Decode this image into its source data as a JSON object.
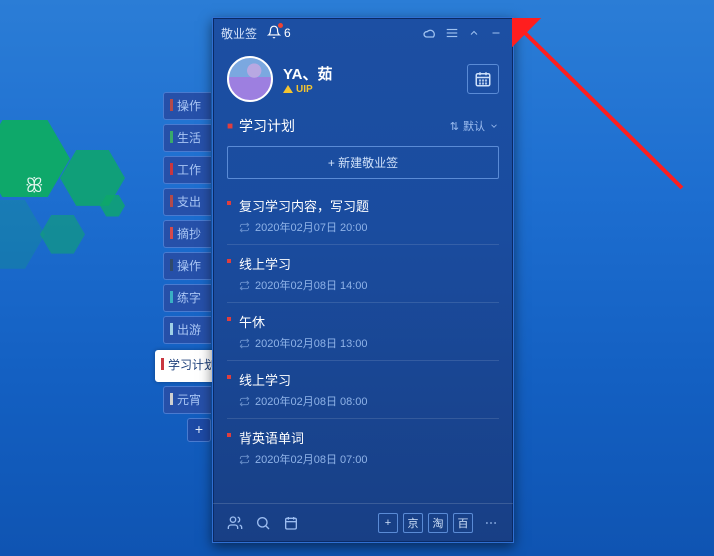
{
  "app": {
    "title": "敬业签",
    "notif_count": "6"
  },
  "user": {
    "name": "YA、茹",
    "vip_label": "UIP"
  },
  "category": {
    "name": "学习计划",
    "sort_label": "默认"
  },
  "new_button": "+ 新建敬业签",
  "tasks": [
    {
      "title": "复习学习内容，写习题",
      "time": "2020年02月07日 20:00"
    },
    {
      "title": "线上学习",
      "time": "2020年02月08日 14:00"
    },
    {
      "title": "午休",
      "time": "2020年02月08日 13:00"
    },
    {
      "title": "线上学习",
      "time": "2020年02月08日 08:00"
    },
    {
      "title": "背英语单词",
      "time": "2020年02月08日 07:00"
    }
  ],
  "side_tabs": {
    "items": [
      "操作",
      "生活",
      "工作",
      "支出",
      "摘抄",
      "操作",
      "练字",
      "出游"
    ],
    "active": "学习计划",
    "after": [
      "元宵"
    ]
  },
  "bottom_boxes": [
    "+",
    "京",
    "淘",
    "百"
  ]
}
